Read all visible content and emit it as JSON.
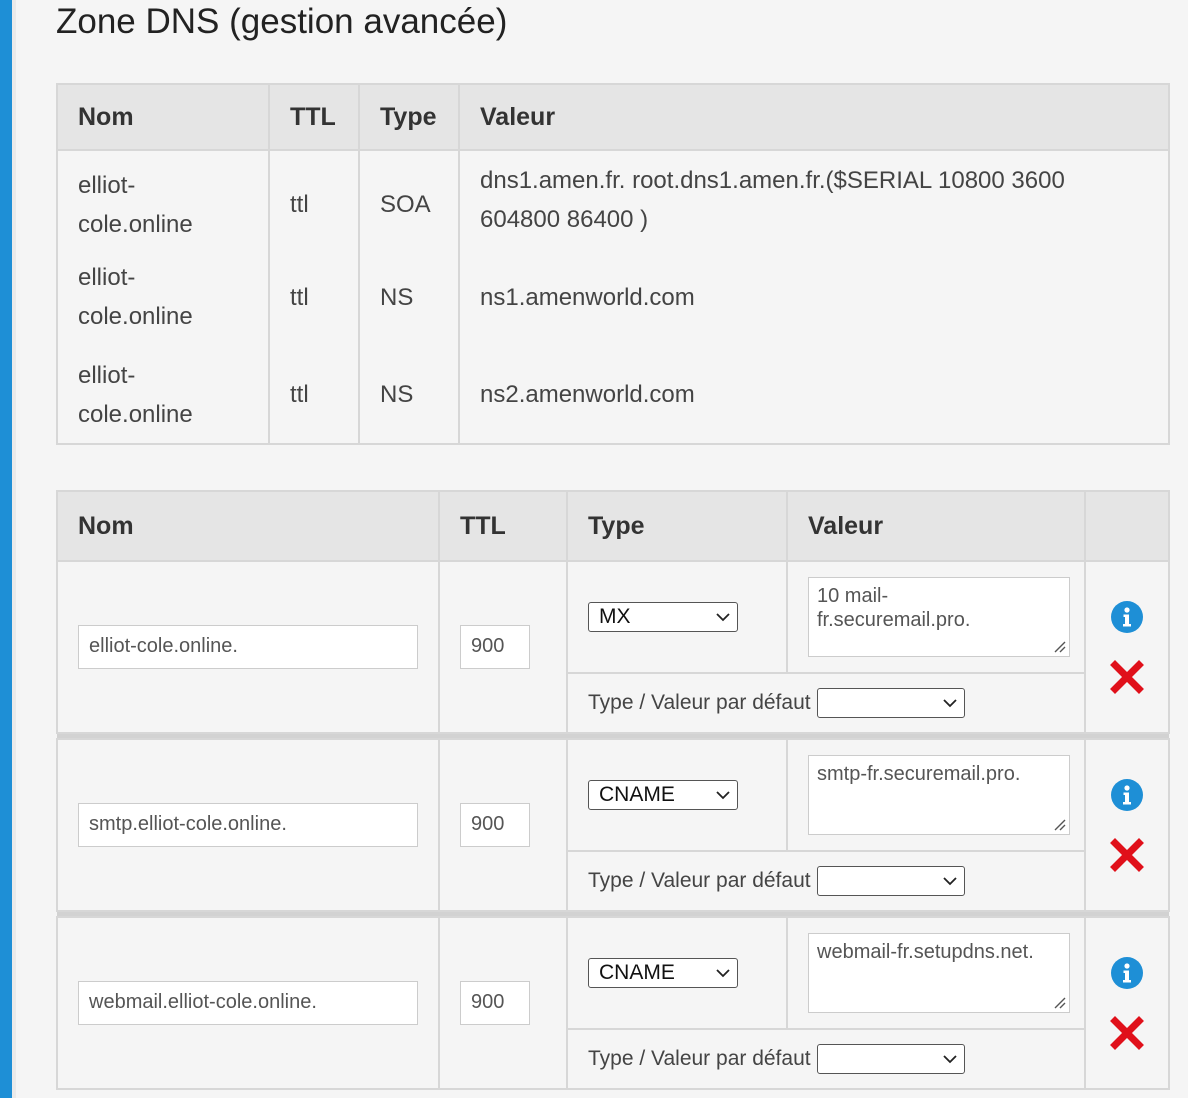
{
  "page_title": "Zone DNS (gestion avancée)",
  "colors": {
    "accent_bar": "#1e8fd6",
    "info_icon": "#1e8fd6",
    "delete_icon": "#e0101a"
  },
  "static_table": {
    "headers": {
      "nom": "Nom",
      "ttl": "TTL",
      "type": "Type",
      "valeur": "Valeur"
    },
    "rows": [
      {
        "nom": "elliot-\ncole.online",
        "ttl": "ttl",
        "type": "SOA",
        "valeur": "dns1.amen.fr. root.dns1.amen.fr.($SERIAL 10800 3600 604800 86400 )"
      },
      {
        "nom": "elliot-\ncole.online",
        "ttl": "ttl",
        "type": "NS",
        "valeur": "ns1.amenworld.com"
      },
      {
        "nom": "elliot-\ncole.online",
        "ttl": "ttl",
        "type": "NS",
        "valeur": "ns2.amenworld.com"
      }
    ]
  },
  "edit_table": {
    "headers": {
      "nom": "Nom",
      "ttl": "TTL",
      "type": "Type",
      "valeur": "Valeur",
      "actions": ""
    },
    "defaults_label": "Type / Valeur par défaut",
    "defaults_selected": "",
    "records": [
      {
        "nom": "elliot-cole.online.",
        "ttl": "900",
        "type": "MX",
        "valeur": "10 mail-\nfr.securemail.pro."
      },
      {
        "nom": "smtp.elliot-cole.online.",
        "ttl": "900",
        "type": "CNAME",
        "valeur": "smtp-fr.securemail.pro."
      },
      {
        "nom": "webmail.elliot-cole.online.",
        "ttl": "900",
        "type": "CNAME",
        "valeur": "webmail-fr.setupdns.net."
      }
    ],
    "icons": {
      "info": "info-circle-icon",
      "delete": "delete-x-icon"
    }
  }
}
